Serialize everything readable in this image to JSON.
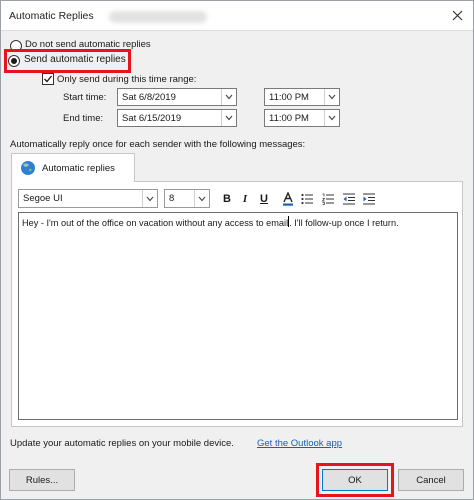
{
  "window": {
    "title": "Automatic Replies"
  },
  "options": {
    "do_not_send_label": "Do not send automatic replies",
    "send_label": "Send automatic replies",
    "only_send_range_label": "Only send during this time range:"
  },
  "schedule": {
    "start_label": "Start time:",
    "start_date": "Sat 6/8/2019",
    "start_time": "11:00 PM",
    "end_label": "End time:",
    "end_date": "Sat 6/15/2019",
    "end_time": "11:00 PM"
  },
  "instructions": "Automatically reply once for each sender with the following messages:",
  "tabs": [
    {
      "label": "Automatic replies"
    }
  ],
  "format_toolbar": {
    "font_family": "Segoe UI",
    "font_size": "8",
    "bold": "B",
    "italic": "I",
    "underline": "U"
  },
  "message": {
    "before_caret": "Hey - I'm out of the office on vacation without any access to email",
    "after_caret": ". I'll follow-up once I return."
  },
  "footer": {
    "mobile_text": "Update your automatic replies on your mobile device.",
    "app_link": "Get the Outlook app",
    "rules_label": "Rules...",
    "ok_label": "OK",
    "cancel_label": "Cancel"
  },
  "colors": {
    "highlight": "#e5141f",
    "link": "#1a5fb4",
    "dialog_background": "#f0f0f0"
  },
  "icons": {
    "close": "close-icon",
    "tab": "globe-icon",
    "dropdown": "chevron-down-icon"
  }
}
